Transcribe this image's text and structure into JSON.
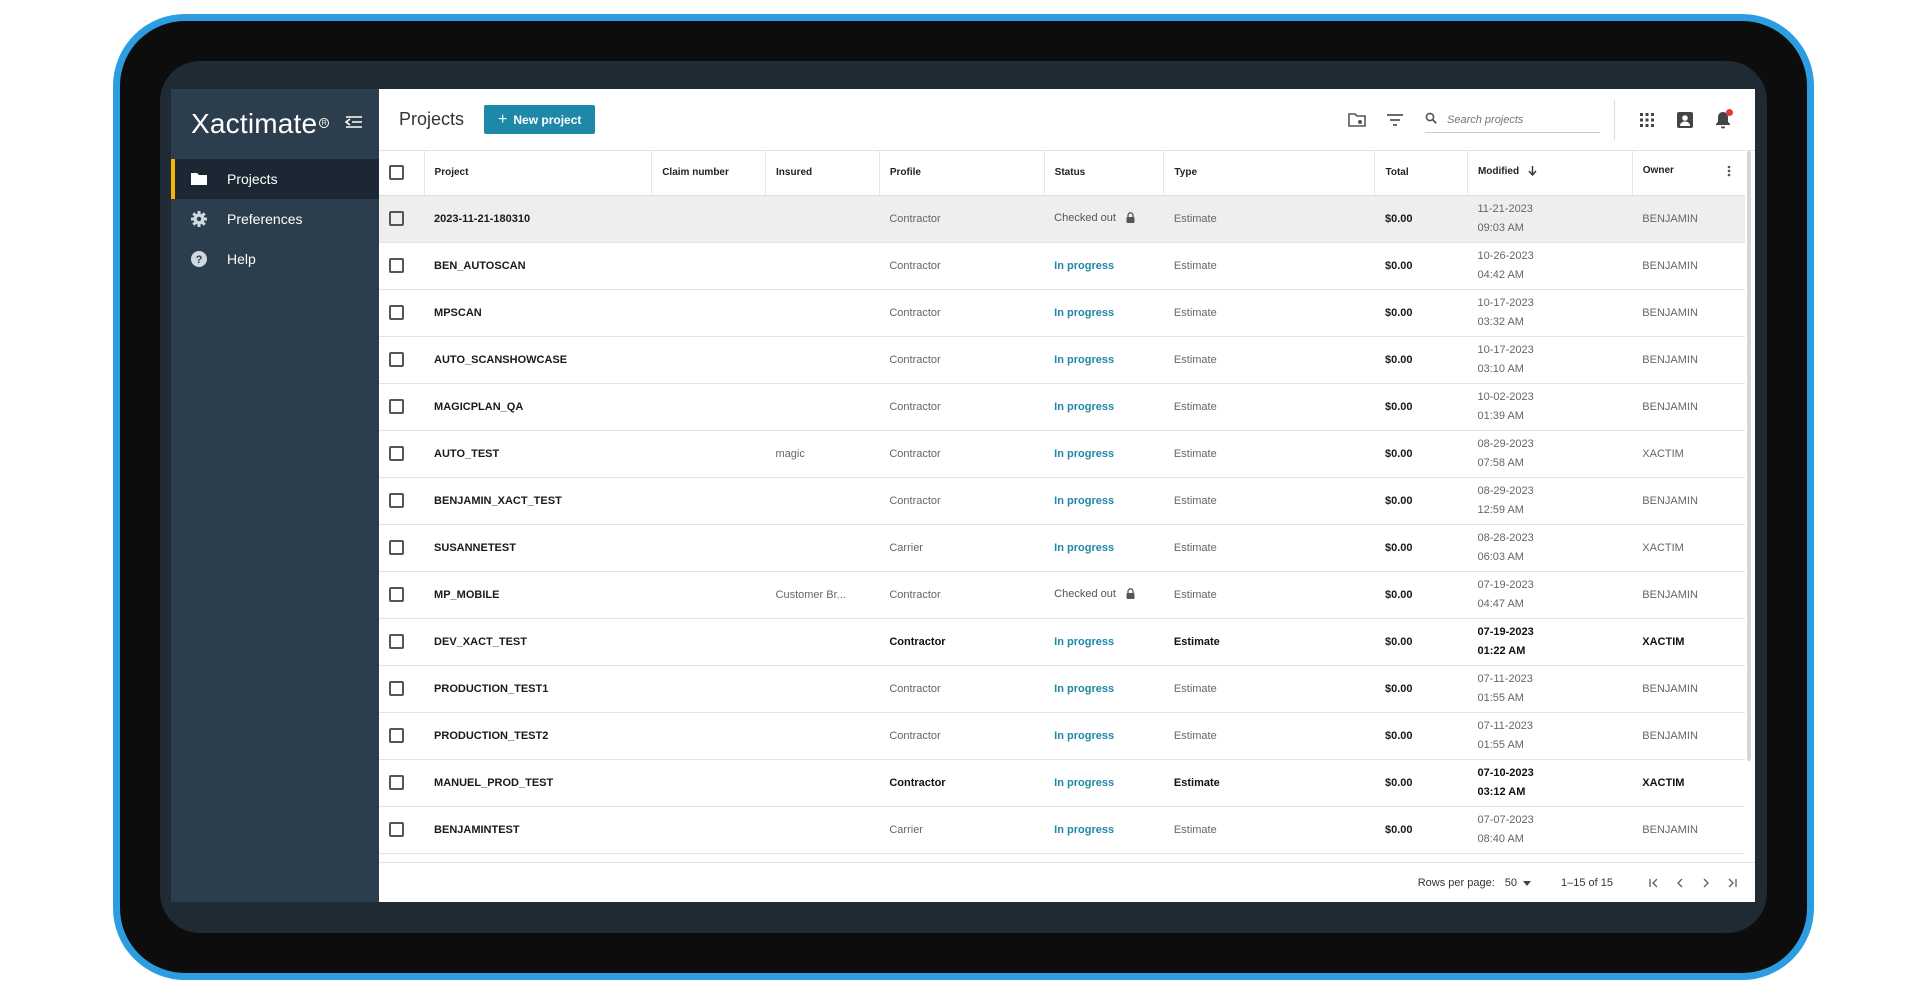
{
  "app": {
    "brand": "Xactimate",
    "reg": "R"
  },
  "sidebar": {
    "items": [
      {
        "label": "Projects",
        "icon": "folder-icon"
      },
      {
        "label": "Preferences",
        "icon": "gear-icon"
      },
      {
        "label": "Help",
        "icon": "help-icon"
      }
    ]
  },
  "header": {
    "title": "Projects",
    "new_button": "New project",
    "search_placeholder": "Search projects"
  },
  "table": {
    "columns": {
      "project": "Project",
      "claim": "Claim number",
      "insured": "Insured",
      "profile": "Profile",
      "status": "Status",
      "type": "Type",
      "total": "Total",
      "modified": "Modified",
      "owner": "Owner"
    },
    "rows": [
      {
        "project": "2023-11-21-180310",
        "claim": "",
        "insured": "",
        "profile": "Contractor",
        "status": "Checked out",
        "type": "Estimate",
        "total": "$0.00",
        "date": "11-21-2023",
        "time": "09:03 AM",
        "owner": "BENJAMIN"
      },
      {
        "project": "BEN_AUTOSCAN",
        "claim": "",
        "insured": "",
        "profile": "Contractor",
        "status": "In progress",
        "type": "Estimate",
        "total": "$0.00",
        "date": "10-26-2023",
        "time": "04:42 AM",
        "owner": "BENJAMIN"
      },
      {
        "project": "MPSCAN",
        "claim": "",
        "insured": "",
        "profile": "Contractor",
        "status": "In progress",
        "type": "Estimate",
        "total": "$0.00",
        "date": "10-17-2023",
        "time": "03:32 AM",
        "owner": "BENJAMIN"
      },
      {
        "project": "AUTO_SCANSHOWCASE",
        "claim": "",
        "insured": "",
        "profile": "Contractor",
        "status": "In progress",
        "type": "Estimate",
        "total": "$0.00",
        "date": "10-17-2023",
        "time": "03:10 AM",
        "owner": "BENJAMIN"
      },
      {
        "project": "MAGICPLAN_QA",
        "claim": "",
        "insured": "",
        "profile": "Contractor",
        "status": "In progress",
        "type": "Estimate",
        "total": "$0.00",
        "date": "10-02-2023",
        "time": "01:39 AM",
        "owner": "BENJAMIN"
      },
      {
        "project": "AUTO_TEST",
        "claim": "",
        "insured": "magic",
        "profile": "Contractor",
        "status": "In progress",
        "type": "Estimate",
        "total": "$0.00",
        "date": "08-29-2023",
        "time": "07:58 AM",
        "owner": "XACTIM"
      },
      {
        "project": "BENJAMIN_XACT_TEST",
        "claim": "",
        "insured": "",
        "profile": "Contractor",
        "status": "In progress",
        "type": "Estimate",
        "total": "$0.00",
        "date": "08-29-2023",
        "time": "12:59 AM",
        "owner": "BENJAMIN"
      },
      {
        "project": "SUSANNETEST",
        "claim": "",
        "insured": "",
        "profile": "Carrier",
        "status": "In progress",
        "type": "Estimate",
        "total": "$0.00",
        "date": "08-28-2023",
        "time": "06:03 AM",
        "owner": "XACTIM"
      },
      {
        "project": "MP_MOBILE",
        "claim": "",
        "insured": "Customer Br...",
        "profile": "Contractor",
        "status": "Checked out",
        "type": "Estimate",
        "total": "$0.00",
        "date": "07-19-2023",
        "time": "04:47 AM",
        "owner": "BENJAMIN"
      },
      {
        "project": "DEV_XACT_TEST",
        "claim": "",
        "insured": "",
        "profile": "Contractor",
        "status": "In progress",
        "type": "Estimate",
        "total": "$0.00",
        "date": "07-19-2023",
        "time": "01:22 AM",
        "owner": "XACTIM"
      },
      {
        "project": "PRODUCTION_TEST1",
        "claim": "",
        "insured": "",
        "profile": "Contractor",
        "status": "In progress",
        "type": "Estimate",
        "total": "$0.00",
        "date": "07-11-2023",
        "time": "01:55 AM",
        "owner": "BENJAMIN"
      },
      {
        "project": "PRODUCTION_TEST2",
        "claim": "",
        "insured": "",
        "profile": "Contractor",
        "status": "In progress",
        "type": "Estimate",
        "total": "$0.00",
        "date": "07-11-2023",
        "time": "01:55 AM",
        "owner": "BENJAMIN"
      },
      {
        "project": "MANUEL_PROD_TEST",
        "claim": "",
        "insured": "",
        "profile": "Contractor",
        "status": "In progress",
        "type": "Estimate",
        "total": "$0.00",
        "date": "07-10-2023",
        "time": "03:12 AM",
        "owner": "XACTIM"
      },
      {
        "project": "BENJAMINTEST",
        "claim": "",
        "insured": "",
        "profile": "Carrier",
        "status": "In progress",
        "type": "Estimate",
        "total": "$0.00",
        "date": "07-07-2023",
        "time": "08:40 AM",
        "owner": "BENJAMIN"
      }
    ]
  },
  "footer": {
    "rows_per_page_label": "Rows per page:",
    "rows_per_page": "50",
    "range": "1–15 of 15"
  },
  "colors": {
    "accent": "#1e88a8",
    "sidebar": "#2c3e4d",
    "active_marker": "#f4b400",
    "frame": "#2b9de0",
    "notification": "#e53935"
  }
}
